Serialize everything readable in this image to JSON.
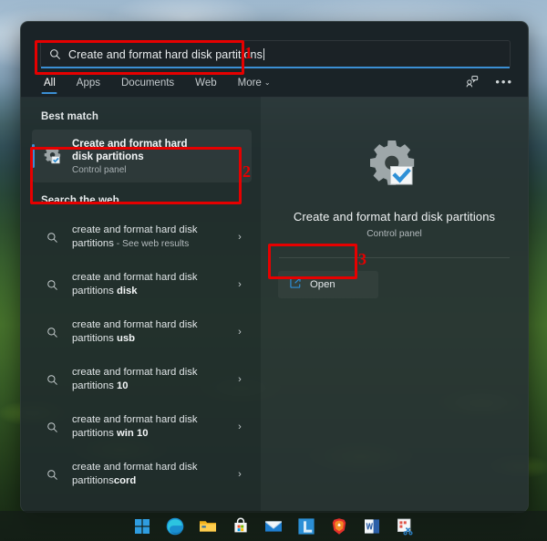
{
  "search": {
    "query": "Create and format hard disk partitions",
    "icon": "search-icon"
  },
  "tabs": [
    {
      "label": "All",
      "active": true
    },
    {
      "label": "Apps",
      "active": false
    },
    {
      "label": "Documents",
      "active": false
    },
    {
      "label": "Web",
      "active": false
    },
    {
      "label": "More",
      "active": false,
      "chevron": "⌄"
    }
  ],
  "top_icons": [
    {
      "name": "feedback-icon"
    },
    {
      "name": "more-options-icon",
      "glyph": "•••"
    }
  ],
  "best_match": {
    "heading": "Best match",
    "title": "Create and format hard disk partitions",
    "subtitle": "Control panel",
    "icon": "control-panel-gear-icon"
  },
  "web_section": {
    "heading": "Search the web",
    "results": [
      {
        "text": "create and format hard disk partitions",
        "suffix": " - See web results",
        "bold": "",
        "chevron": "›"
      },
      {
        "text": "create and format hard disk partitions ",
        "suffix": "",
        "bold": "disk",
        "chevron": "›"
      },
      {
        "text": "create and format hard disk partitions ",
        "suffix": "",
        "bold": "usb",
        "chevron": "›"
      },
      {
        "text": "create and format hard disk partitions ",
        "suffix": "",
        "bold": "10",
        "chevron": "›"
      },
      {
        "text": "create and format hard disk partitions ",
        "suffix": "",
        "bold": "win 10",
        "chevron": "›"
      },
      {
        "text": "create and format hard disk partitions",
        "suffix": "",
        "bold": "cord",
        "chevron": "›"
      }
    ]
  },
  "preview": {
    "title": "Create and format hard disk partitions",
    "subtitle": "Control panel",
    "icon": "control-panel-gear-check-icon",
    "open_label": "Open",
    "open_icon": "open-external-icon"
  },
  "annotations": [
    {
      "number": "1",
      "target": "search-input"
    },
    {
      "number": "2",
      "target": "best-match-result"
    },
    {
      "number": "3",
      "target": "open-button"
    }
  ],
  "taskbar": {
    "items": [
      {
        "name": "start-button",
        "label": "Start"
      },
      {
        "name": "edge-icon",
        "label": "Microsoft Edge"
      },
      {
        "name": "file-explorer-icon",
        "label": "File Explorer"
      },
      {
        "name": "microsoft-store-icon",
        "label": "Microsoft Store"
      },
      {
        "name": "mail-icon",
        "label": "Mail"
      },
      {
        "name": "app-l-icon",
        "label": "L"
      },
      {
        "name": "brave-browser-icon",
        "label": "Brave"
      },
      {
        "name": "word-icon",
        "label": "Word"
      },
      {
        "name": "snipping-tool-icon",
        "label": "Snipping Tool"
      }
    ]
  },
  "colors": {
    "accent": "#3b8fd4",
    "annotation": "#e60000",
    "panel_bg": "#202c2c",
    "text_primary": "#f2f5f6",
    "text_secondary": "#a9b1b4"
  }
}
